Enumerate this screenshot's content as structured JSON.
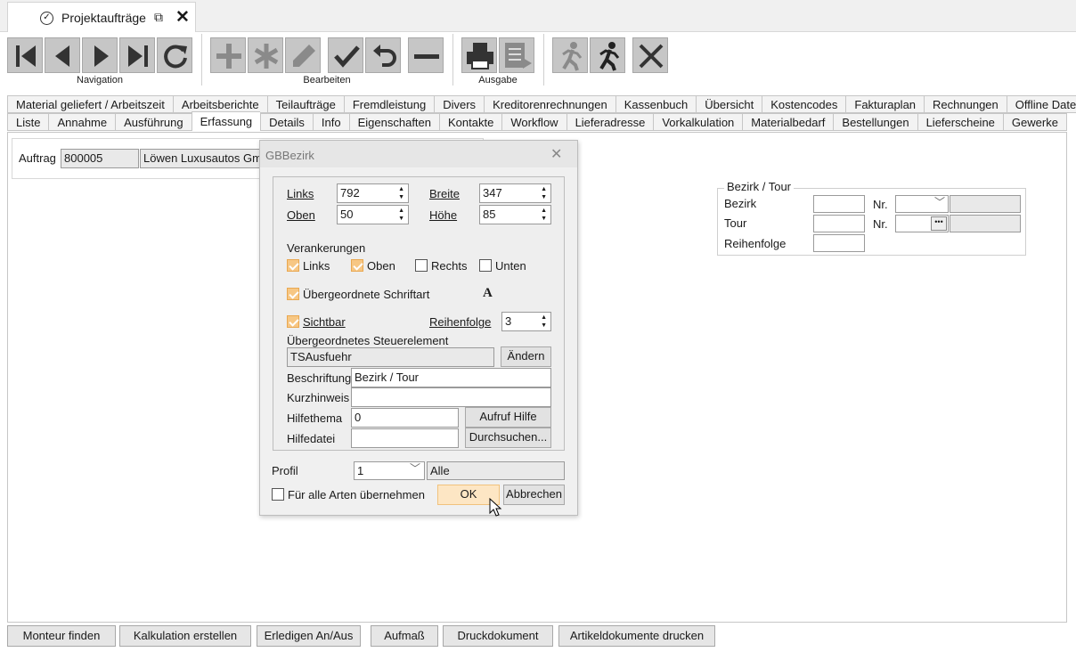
{
  "window": {
    "tab_title": "Projektaufträge"
  },
  "toolbar": {
    "navigation_label": "Navigation",
    "edit_label": "Bearbeiten",
    "output_label": "Ausgabe"
  },
  "tabs_row1": [
    "Material geliefert / Arbeitszeit",
    "Arbeitsberichte",
    "Teilaufträge",
    "Fremdleistung",
    "Divers",
    "Kreditorenrechnungen",
    "Kassenbuch",
    "Übersicht",
    "Kostencodes",
    "Fakturaplan",
    "Rechnungen",
    "Offline Daten"
  ],
  "tabs_row2": [
    "Liste",
    "Annahme",
    "Ausführung",
    "Erfassung",
    "Details",
    "Info",
    "Eigenschaften",
    "Kontakte",
    "Workflow",
    "Lieferadresse",
    "Vorkalkulation",
    "Materialbedarf",
    "Bestellungen",
    "Lieferscheine",
    "Gewerke"
  ],
  "active_tab": "Erfassung",
  "order": {
    "label": "Auftrag",
    "number": "800005",
    "customer": "Löwen Luxusautos Gm"
  },
  "bezirk_panel": {
    "title": "Bezirk / Tour",
    "bezirk_label": "Bezirk",
    "tour_label": "Tour",
    "nr_label": "Nr.",
    "reihenfolge_label": "Reihenfolge"
  },
  "dialog": {
    "title": "GBBezirk",
    "links_label": "Links",
    "links_value": "792",
    "breite_label": "Breite",
    "breite_value": "347",
    "oben_label": "Oben",
    "oben_value": "50",
    "hoehe_label": "Höhe",
    "hoehe_value": "85",
    "verankerungen_label": "Verankerungen",
    "anchors": [
      {
        "label": "Links",
        "checked": true
      },
      {
        "label": "Oben",
        "checked": true
      },
      {
        "label": "Rechts",
        "checked": false
      },
      {
        "label": "Unten",
        "checked": false
      }
    ],
    "font_label": "Übergeordnete Schriftart",
    "font_icon": "A",
    "sichtbar_label": "Sichtbar",
    "reihenfolge_label": "Reihenfolge",
    "reihenfolge_value": "3",
    "parent_label": "Übergeordnetes Steuerelement",
    "parent_value": "TSAusfuehr",
    "change_button": "Ändern",
    "beschriftung_label": "Beschriftung",
    "beschriftung_value": "Bezirk / Tour",
    "kurzhinweis_label": "Kurzhinweis",
    "kurzhinweis_value": "",
    "hilfethema_label": "Hilfethema",
    "hilfethema_value": "0",
    "aufruf_hilfe_button": "Aufruf Hilfe",
    "hilfedatei_label": "Hilfedatei",
    "hilfedatei_value": "",
    "durchsuchen_button": "Durchsuchen...",
    "profil_label": "Profil",
    "profil_value": "1",
    "profil_text": "Alle",
    "apply_all_label": "Für alle Arten übernehmen",
    "ok_button": "OK",
    "cancel_button": "Abbrechen"
  },
  "bottom_buttons": [
    "Monteur finden",
    "Kalkulation erstellen",
    "Erledigen An/Aus",
    "Aufmaß",
    "Druckdokument",
    "Artikeldokumente drucken"
  ]
}
